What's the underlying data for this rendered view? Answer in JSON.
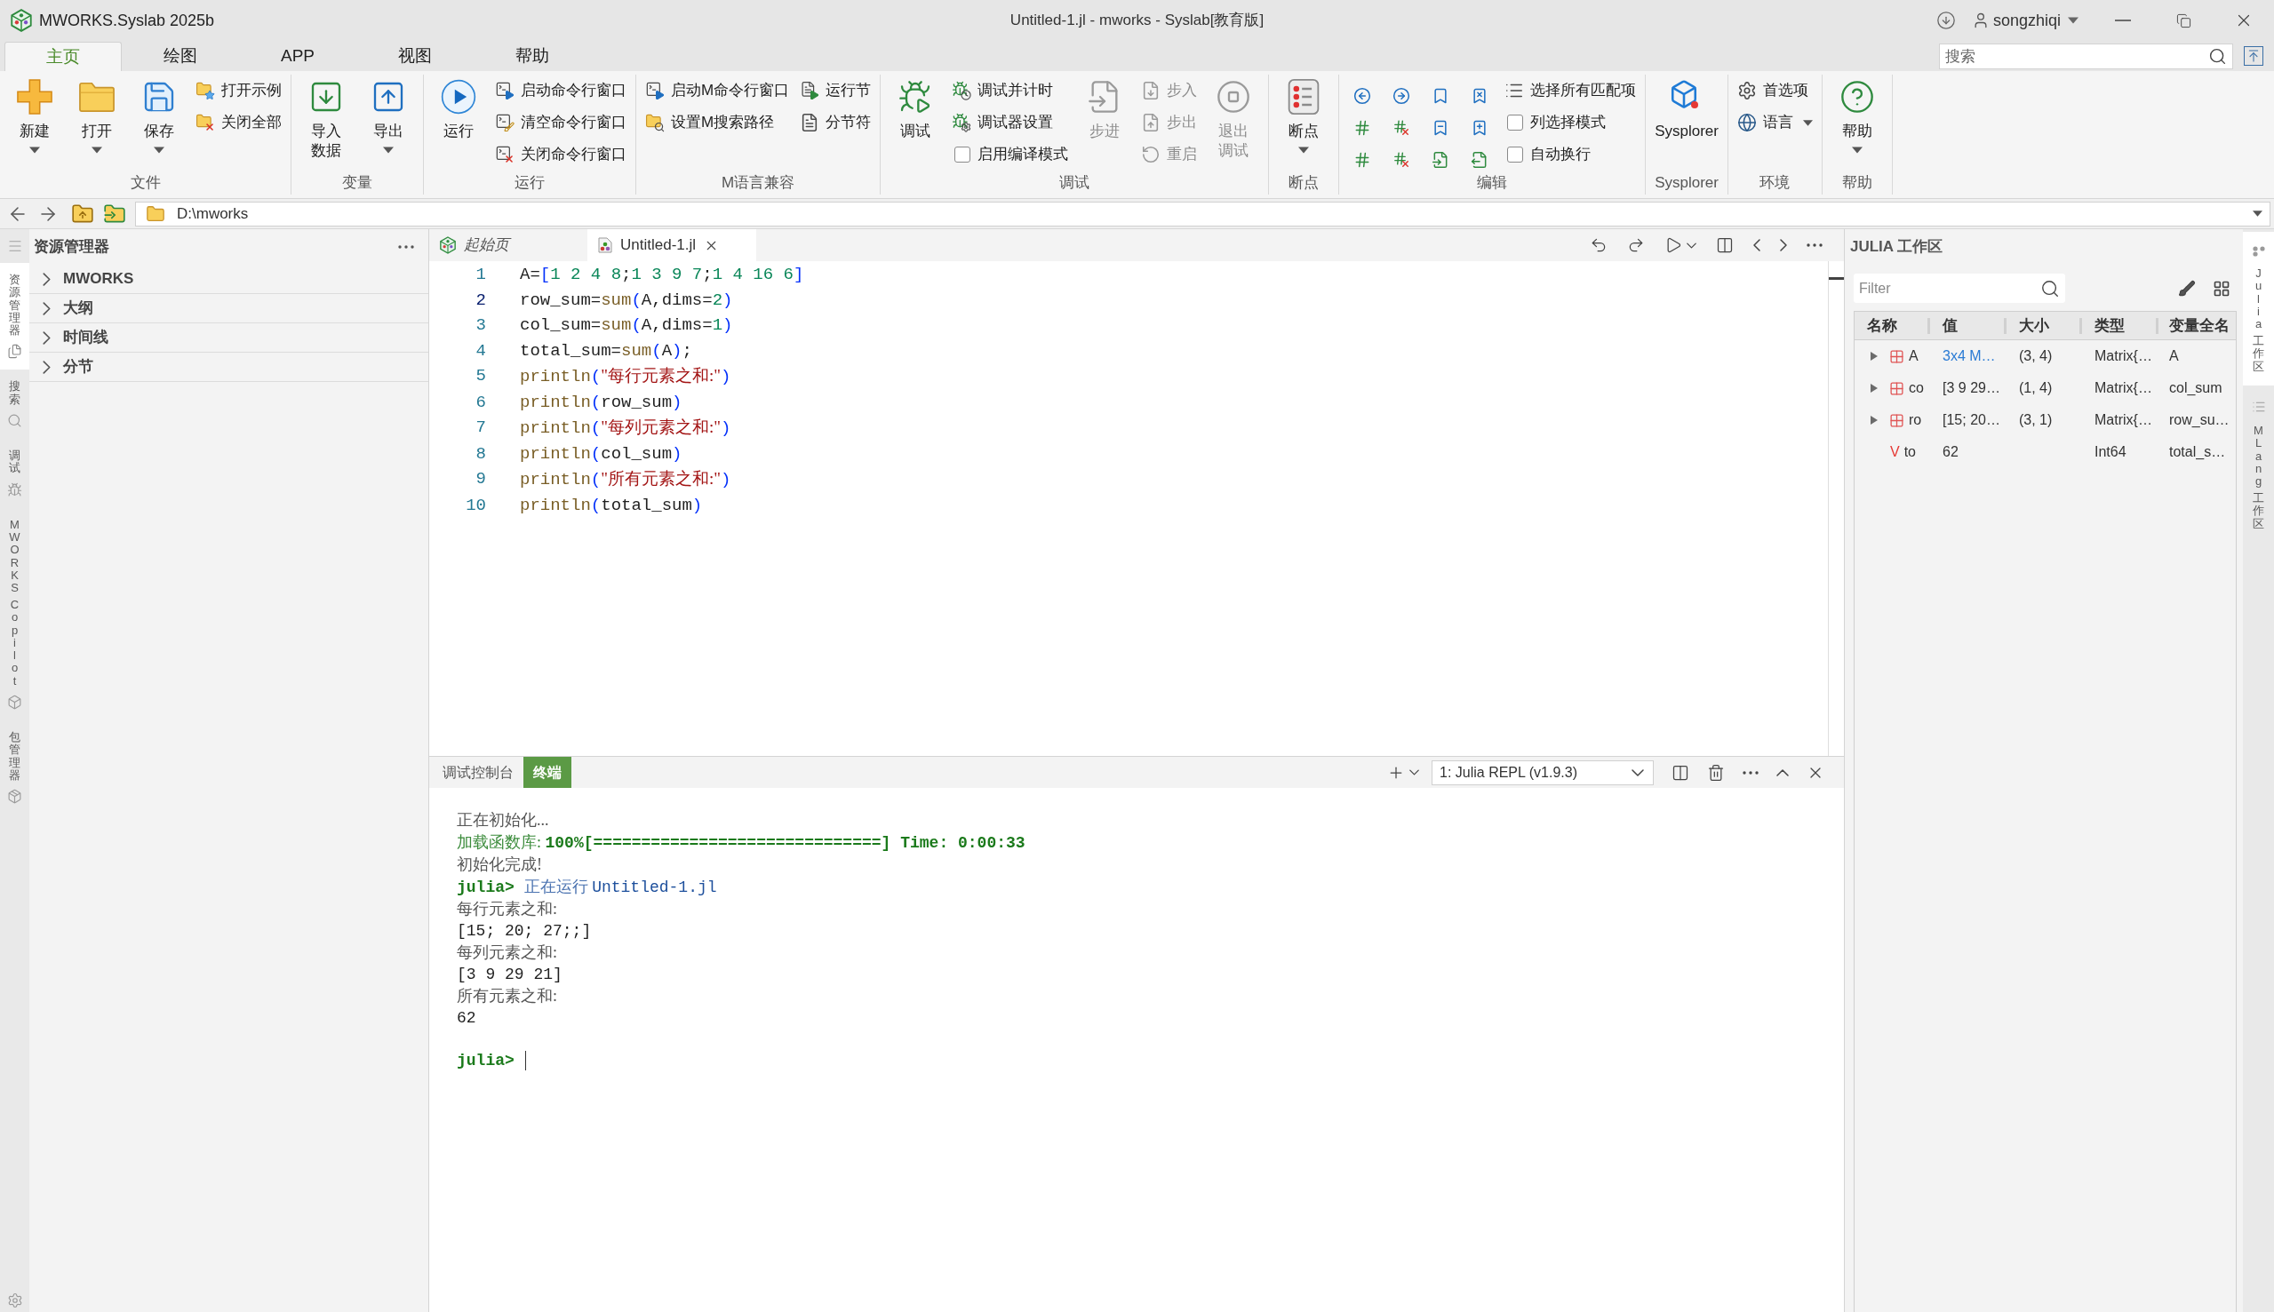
{
  "title_bar": {
    "app_name": "MWORKS.Syslab 2025b",
    "title": "Untitled-1.jl - mworks - Syslab[教育版]",
    "user": "songzhiqi"
  },
  "ribbon": {
    "tabs": [
      {
        "label": "主页",
        "selected": true
      },
      {
        "label": "绘图",
        "selected": false
      },
      {
        "label": "APP",
        "selected": false
      },
      {
        "label": "视图",
        "selected": false
      },
      {
        "label": "帮助",
        "selected": false
      }
    ],
    "search": {
      "placeholder": "搜索"
    },
    "groups": [
      {
        "label": "文件",
        "items": [
          {
            "kind": "big",
            "label": "新建",
            "dropdown": true,
            "disabled": false
          },
          {
            "kind": "big",
            "label": "打开",
            "dropdown": true,
            "disabled": false
          },
          {
            "kind": "big",
            "label": "保存",
            "dropdown": true,
            "disabled": false
          },
          {
            "kind": "column",
            "items": [
              {
                "kind": "small",
                "label": "打开示例",
                "dropdown": false,
                "disabled": false
              },
              {
                "kind": "small",
                "label": "关闭全部",
                "dropdown": false,
                "disabled": false
              }
            ]
          }
        ]
      },
      {
        "label": "变量",
        "items": [
          {
            "kind": "big",
            "label": "导入数据",
            "dropdown": false,
            "disabled": false
          },
          {
            "kind": "big",
            "label": "导出",
            "dropdown": true,
            "disabled": false
          }
        ]
      },
      {
        "label": "运行",
        "items": [
          {
            "kind": "big",
            "label": "运行",
            "dropdown": false,
            "disabled": false
          },
          {
            "kind": "column",
            "items": [
              {
                "kind": "small",
                "label": "启动命令行窗口",
                "dropdown": false,
                "disabled": false
              },
              {
                "kind": "small",
                "label": "清空命令行窗口",
                "dropdown": false,
                "disabled": false
              },
              {
                "kind": "small",
                "label": "关闭命令行窗口",
                "dropdown": false,
                "disabled": false
              }
            ]
          }
        ]
      },
      {
        "label": "M语言兼容",
        "items": [
          {
            "kind": "column",
            "items": [
              {
                "kind": "small",
                "label": "启动M命令行窗口",
                "dropdown": false,
                "disabled": false
              },
              {
                "kind": "small",
                "label": "设置M搜索路径",
                "dropdown": false,
                "disabled": false
              }
            ]
          },
          {
            "kind": "column",
            "items": [
              {
                "kind": "small",
                "label": "运行节",
                "dropdown": false,
                "disabled": false
              },
              {
                "kind": "small",
                "label": "分节符",
                "dropdown": false,
                "disabled": false
              }
            ]
          }
        ]
      },
      {
        "label": "调试",
        "items": [
          {
            "kind": "big",
            "label": "调试",
            "dropdown": false,
            "disabled": false
          },
          {
            "kind": "column",
            "items": [
              {
                "kind": "small",
                "label": "调试并计时",
                "dropdown": false,
                "disabled": false
              },
              {
                "kind": "small",
                "label": "调试器设置",
                "dropdown": false,
                "disabled": false
              },
              {
                "kind": "check",
                "label": "启用编译模式",
                "checked": false
              }
            ]
          },
          {
            "kind": "big",
            "label": "步进",
            "dropdown": false,
            "disabled": true
          },
          {
            "kind": "column",
            "items": [
              {
                "kind": "small",
                "label": "步入",
                "dropdown": false,
                "disabled": true
              },
              {
                "kind": "small",
                "label": "步出",
                "dropdown": false,
                "disabled": true
              },
              {
                "kind": "small",
                "label": "重启",
                "dropdown": false,
                "disabled": true
              }
            ]
          },
          {
            "kind": "big",
            "label": "退出调试",
            "dropdown": false,
            "disabled": true
          }
        ]
      },
      {
        "label": "断点",
        "items": [
          {
            "kind": "big",
            "label": "断点",
            "dropdown": true,
            "disabled": false
          }
        ]
      },
      {
        "label": "编辑",
        "items": [
          {
            "kind": "icon_grid"
          },
          {
            "kind": "column",
            "items": [
              {
                "kind": "small",
                "label": "选择所有匹配项",
                "dropdown": false,
                "disabled": false
              },
              {
                "kind": "check",
                "label": "列选择模式",
                "checked": false
              },
              {
                "kind": "check",
                "label": "自动换行",
                "checked": false
              }
            ]
          }
        ]
      },
      {
        "label": "Sysplorer",
        "items": [
          {
            "kind": "big",
            "label": "Sysplorer",
            "dropdown": false,
            "disabled": false
          }
        ]
      },
      {
        "label": "环境",
        "items": [
          {
            "kind": "column",
            "items": [
              {
                "kind": "small",
                "label": "首选项",
                "dropdown": false,
                "disabled": false
              },
              {
                "kind": "small",
                "label": "语言",
                "dropdown": true,
                "disabled": false
              }
            ]
          }
        ]
      },
      {
        "label": "帮助",
        "items": [
          {
            "kind": "big",
            "label": "帮助",
            "dropdown": true,
            "disabled": false
          }
        ]
      }
    ]
  },
  "address_bar": {
    "path": "D:\\mworks"
  },
  "activity_bar": [
    {
      "label": "资源管理器",
      "selected": true
    },
    {
      "label": "搜索",
      "selected": false
    },
    {
      "label": "调试",
      "selected": false
    },
    {
      "label": "MWORKS Copilot",
      "selected": false
    },
    {
      "label": "包管理器",
      "selected": false
    }
  ],
  "explorer": {
    "title": "资源管理器",
    "sections": [
      {
        "label": "MWORKS",
        "expanded": false
      },
      {
        "label": "大纲",
        "expanded": false
      },
      {
        "label": "时间线",
        "expanded": false
      },
      {
        "label": "分节",
        "expanded": false
      }
    ]
  },
  "editor": {
    "tabs": [
      {
        "label": "起始页",
        "selected": false,
        "preview": true
      },
      {
        "label": "Untitled-1.jl",
        "selected": true,
        "preview": false
      }
    ],
    "lines": [
      {
        "number": "1",
        "active": false,
        "tokens": [
          {
            "text": "A=",
            "kind": "plain"
          },
          {
            "text": "[",
            "kind": "bracket"
          },
          {
            "text": "1 2 4 8",
            "kind": "number"
          },
          {
            "text": ";",
            "kind": "plain"
          },
          {
            "text": "1 3 9 7",
            "kind": "number"
          },
          {
            "text": ";",
            "kind": "plain"
          },
          {
            "text": "1 4 16 6",
            "kind": "number"
          },
          {
            "text": "]",
            "kind": "bracket"
          }
        ]
      },
      {
        "number": "2",
        "active": true,
        "tokens": [
          {
            "text": "row_sum=",
            "kind": "plain"
          },
          {
            "text": "sum",
            "kind": "func"
          },
          {
            "text": "(",
            "kind": "bracket"
          },
          {
            "text": "A,dims=",
            "kind": "plain"
          },
          {
            "text": "2",
            "kind": "number"
          },
          {
            "text": ")",
            "kind": "bracket"
          }
        ]
      },
      {
        "number": "3",
        "active": false,
        "tokens": [
          {
            "text": "col_sum=",
            "kind": "plain"
          },
          {
            "text": "sum",
            "kind": "func"
          },
          {
            "text": "(",
            "kind": "bracket"
          },
          {
            "text": "A,dims=",
            "kind": "plain"
          },
          {
            "text": "1",
            "kind": "number"
          },
          {
            "text": ")",
            "kind": "bracket"
          }
        ]
      },
      {
        "number": "4",
        "active": false,
        "tokens": [
          {
            "text": "total_sum=",
            "kind": "plain"
          },
          {
            "text": "sum",
            "kind": "func"
          },
          {
            "text": "(",
            "kind": "bracket"
          },
          {
            "text": "A",
            "kind": "plain"
          },
          {
            "text": ")",
            "kind": "bracket"
          },
          {
            "text": ";",
            "kind": "plain"
          }
        ]
      },
      {
        "number": "5",
        "active": false,
        "tokens": [
          {
            "text": "println",
            "kind": "func"
          },
          {
            "text": "(",
            "kind": "bracket"
          },
          {
            "text": "\"每行元素之和:\"",
            "kind": "string"
          },
          {
            "text": ")",
            "kind": "bracket"
          }
        ]
      },
      {
        "number": "6",
        "active": false,
        "tokens": [
          {
            "text": "println",
            "kind": "func"
          },
          {
            "text": "(",
            "kind": "bracket"
          },
          {
            "text": "row_sum",
            "kind": "plain"
          },
          {
            "text": ")",
            "kind": "bracket"
          }
        ]
      },
      {
        "number": "7",
        "active": false,
        "tokens": [
          {
            "text": "println",
            "kind": "func"
          },
          {
            "text": "(",
            "kind": "bracket"
          },
          {
            "text": "\"每列元素之和:\"",
            "kind": "string"
          },
          {
            "text": ")",
            "kind": "bracket"
          }
        ]
      },
      {
        "number": "8",
        "active": false,
        "tokens": [
          {
            "text": "println",
            "kind": "func"
          },
          {
            "text": "(",
            "kind": "bracket"
          },
          {
            "text": "col_sum",
            "kind": "plain"
          },
          {
            "text": ")",
            "kind": "bracket"
          }
        ]
      },
      {
        "number": "9",
        "active": false,
        "tokens": [
          {
            "text": "println",
            "kind": "func"
          },
          {
            "text": "(",
            "kind": "bracket"
          },
          {
            "text": "\"所有元素之和:\"",
            "kind": "string"
          },
          {
            "text": ")",
            "kind": "bracket"
          }
        ]
      },
      {
        "number": "10",
        "active": false,
        "tokens": [
          {
            "text": "println",
            "kind": "func"
          },
          {
            "text": "(",
            "kind": "bracket"
          },
          {
            "text": "total_sum",
            "kind": "plain"
          },
          {
            "text": ")",
            "kind": "bracket"
          }
        ]
      }
    ]
  },
  "terminal": {
    "tabs": [
      {
        "label": "调试控制台",
        "selected": false
      },
      {
        "label": "终端",
        "selected": true
      }
    ],
    "selector": {
      "value": "1: Julia REPL (v1.9.3)"
    },
    "lines": [
      {
        "tokens": [
          {
            "text": "正在初始化...",
            "kind": "note"
          }
        ]
      },
      {
        "tokens": [
          {
            "text": "加载函数库: ",
            "kind": "label"
          },
          {
            "text": "100%[==============================] Time: 0:00:33",
            "kind": "progress"
          }
        ]
      },
      {
        "tokens": [
          {
            "text": "初始化完成!",
            "kind": "note"
          }
        ]
      },
      {
        "tokens": [
          {
            "text": "julia> ",
            "kind": "prompt"
          },
          {
            "text": "正在运行 ",
            "kind": "run"
          },
          {
            "text": "Untitled-1.jl",
            "kind": "file"
          }
        ]
      },
      {
        "tokens": [
          {
            "text": "每行元素之和:",
            "kind": "note"
          }
        ]
      },
      {
        "tokens": [
          {
            "text": "[15; 20; 27;;]",
            "kind": "output"
          }
        ]
      },
      {
        "tokens": [
          {
            "text": "每列元素之和:",
            "kind": "note"
          }
        ]
      },
      {
        "tokens": [
          {
            "text": "[3 9 29 21]",
            "kind": "output"
          }
        ]
      },
      {
        "tokens": [
          {
            "text": "所有元素之和:",
            "kind": "note"
          }
        ]
      },
      {
        "tokens": [
          {
            "text": "62",
            "kind": "output"
          }
        ]
      }
    ],
    "prompt": "julia>"
  },
  "workspace": {
    "title": "JULIA 工作区",
    "filter": {
      "placeholder": "Filter"
    },
    "columns": [
      "名称",
      "值",
      "大小",
      "类型",
      "变量全名"
    ],
    "rows": [
      {
        "kind": "matrix",
        "expanded": false,
        "name": "A",
        "value": "3x4 M…",
        "value_link": true,
        "size": "(3, 4)",
        "type": "Matrix{…",
        "full_name": "A"
      },
      {
        "kind": "matrix",
        "expanded": false,
        "name": "co",
        "value": "[3 9 29…",
        "value_link": false,
        "size": "(1, 4)",
        "type": "Matrix{…",
        "full_name": "col_sum"
      },
      {
        "kind": "matrix",
        "expanded": false,
        "name": "ro",
        "value": "[15; 20…",
        "value_link": false,
        "size": "(3, 1)",
        "type": "Matrix{…",
        "full_name": "row_su…"
      },
      {
        "kind": "scalar",
        "badge": "V",
        "name": "to",
        "value": "62",
        "value_link": false,
        "type": "Int64",
        "full_name": "total_s…"
      }
    ]
  },
  "side_tabs": [
    {
      "label": "Julia 工作区",
      "selected": true
    },
    {
      "label": "MLang 工作区",
      "selected": false
    }
  ]
}
